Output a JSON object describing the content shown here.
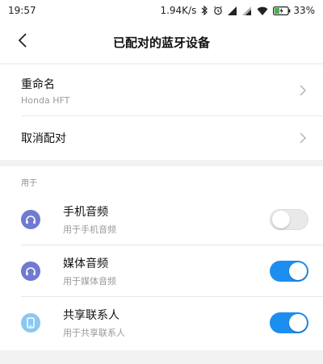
{
  "status_bar": {
    "time": "19:57",
    "net_speed": "1.94K/s",
    "battery_percent": "33%",
    "icons": [
      "bluetooth-icon",
      "alarm-icon",
      "signal-icon",
      "signal-icon",
      "wifi-icon",
      "battery-charging-icon"
    ]
  },
  "app_bar": {
    "title": "已配对的蓝牙设备",
    "back_icon": "chevron-left-icon"
  },
  "device_group": {
    "rename": {
      "title": "重命名",
      "subtitle": "Honda HFT"
    },
    "unpair": {
      "title": "取消配对"
    }
  },
  "profiles": {
    "section_label": "用于",
    "items": [
      {
        "title": "手机音频",
        "subtitle": "用于手机音频",
        "icon": "headphones-icon",
        "enabled": false,
        "icon_color": "#6f7bd0"
      },
      {
        "title": "媒体音频",
        "subtitle": "用于媒体音频",
        "icon": "headphones-icon",
        "enabled": true,
        "icon_color": "#6f7bd0"
      },
      {
        "title": "共享联系人",
        "subtitle": "用于共享联系人",
        "icon": "phone-icon",
        "enabled": true,
        "icon_color": "#8cc7f2"
      }
    ]
  },
  "colors": {
    "accent": "#1c8ef0",
    "toggle_off": "#e9e9e9"
  }
}
